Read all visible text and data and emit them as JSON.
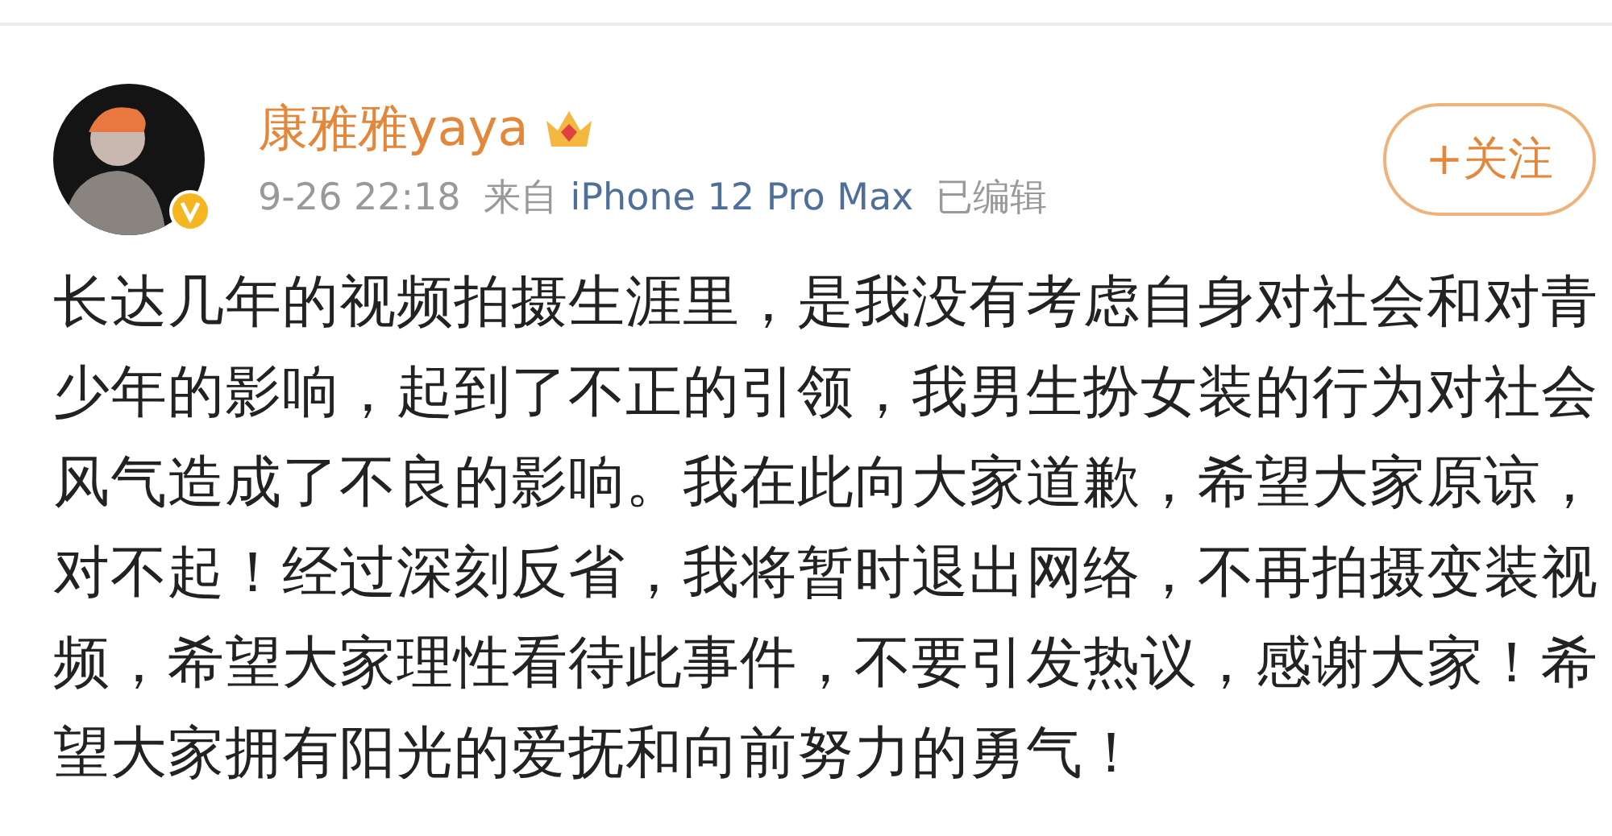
{
  "post": {
    "author": "康雅雅yaya",
    "time": "9-26 22:18",
    "source_prefix": "来自",
    "source": "iPhone 12 Pro Max",
    "edited_label": "已编辑",
    "verified": true,
    "follow_button": "+关注",
    "text": "长达几年的视频拍摄生涯里，是我没有考虑自身对社会和对青少年的影响，起到了不正的引领，我男生扮女装的行为对社会风气造成了不良的影响。我在此向大家道歉，希望大家原谅，对不起！经过深刻反省，我将暂时退出网络，不再拍摄变装视频，希望大家理性看待此事件，不要引发热议，感谢大家！希望大家拥有阳光的爱抚和向前努力的勇气！"
  }
}
